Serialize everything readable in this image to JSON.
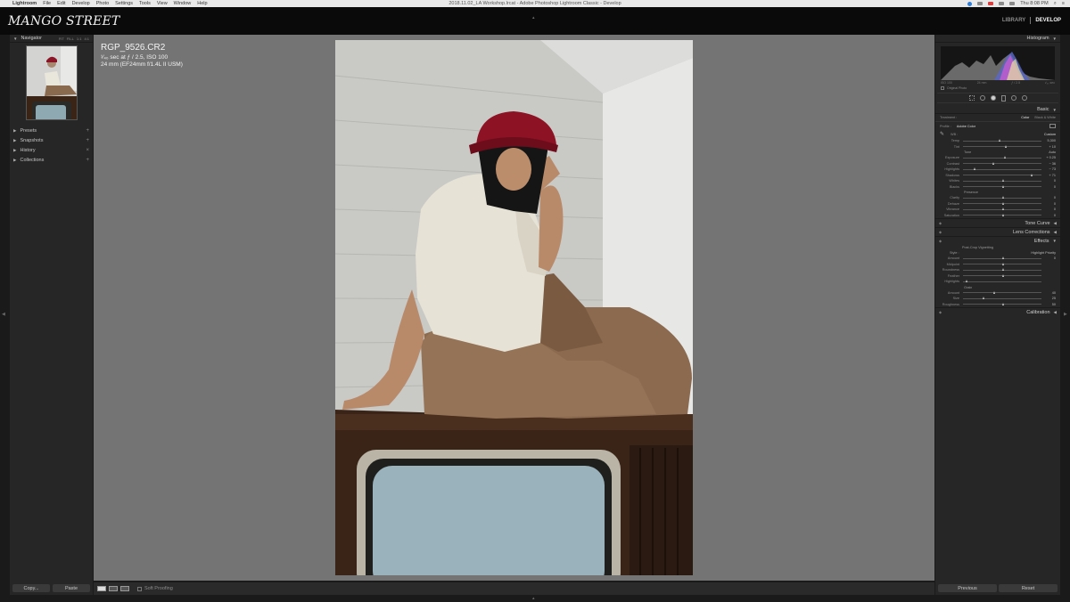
{
  "menubar": {
    "items": [
      "Lightroom",
      "File",
      "Edit",
      "Develop",
      "Photo",
      "Settings",
      "Tools",
      "View",
      "Window",
      "Help"
    ],
    "title": "2018.11.02_LA Workshop.lrcat - Adobe Photoshop Lightroom Classic - Develop",
    "clock": "Thu 8:08 PM"
  },
  "identity": {
    "logo": "MANGO STREET",
    "modules": [
      "LIBRARY",
      "DEVELOP"
    ]
  },
  "left_panel": {
    "navigator": {
      "title": "Navigator",
      "options": [
        "FIT",
        "FILL",
        "1:1",
        "4:1"
      ]
    },
    "sections": [
      {
        "label": "Presets"
      },
      {
        "label": "Snapshots"
      },
      {
        "label": "History"
      },
      {
        "label": "Collections"
      }
    ]
  },
  "image_info": {
    "filename": "RGP_9526.CR2",
    "exposure": "¹⁄₄₀ sec at ƒ / 2.5, ISO 100",
    "lens": "24 mm (EF24mm f/1.4L II USM)"
  },
  "right_panel": {
    "histogram": {
      "title": "Histogram",
      "meta": [
        "ISO 100",
        "24 mm",
        "ƒ / 2.5",
        "¹⁄₄₀ sec"
      ],
      "original_photo": "Original Photo"
    },
    "basic": {
      "title": "Basic",
      "treatment_label": "Treatment :",
      "treatment_options": [
        "Color",
        "Black & White"
      ],
      "profile_label": "Profile :",
      "profile_value": "Adobe Color",
      "wb_label": "WB :",
      "wb_value": "Custom",
      "wb_sliders": [
        {
          "label": "Temp",
          "value": "5,300",
          "pos": 0.45
        },
        {
          "label": "Tint",
          "value": "+ 10",
          "pos": 0.53
        }
      ],
      "tone_label": "Tone",
      "tone_auto": "Auto",
      "tone_sliders": [
        {
          "label": "Exposure",
          "value": "+ 0.25",
          "pos": 0.52
        },
        {
          "label": "Contrast",
          "value": "− 36",
          "pos": 0.38
        },
        {
          "label": "Highlights",
          "value": "− 73",
          "pos": 0.14
        },
        {
          "label": "Shadows",
          "value": "+ 71",
          "pos": 0.86
        },
        {
          "label": "Whites",
          "value": "0",
          "pos": 0.5
        },
        {
          "label": "Blacks",
          "value": "0",
          "pos": 0.5
        }
      ],
      "presence_label": "Presence",
      "presence_sliders": [
        {
          "label": "Clarity",
          "value": "0",
          "pos": 0.5
        },
        {
          "label": "Dehaze",
          "value": "0",
          "pos": 0.5
        },
        {
          "label": "Vibrance",
          "value": "0",
          "pos": 0.5
        },
        {
          "label": "Saturation",
          "value": "0",
          "pos": 0.5
        }
      ]
    },
    "collapsed_panels": [
      "Tone Curve",
      "Lens Corrections"
    ],
    "effects": {
      "title": "Effects",
      "vignette_label": "Post-Crop Vignetting",
      "style_label": "Style :",
      "style_value": "Highlight Priority",
      "vignette_sliders": [
        {
          "label": "Amount",
          "value": "0",
          "pos": 0.5
        },
        {
          "label": "Midpoint",
          "value": "",
          "pos": 0.5
        },
        {
          "label": "Roundness",
          "value": "",
          "pos": 0.5
        },
        {
          "label": "Feather",
          "value": "",
          "pos": 0.5
        },
        {
          "label": "Highlights",
          "value": "",
          "pos": 0.03
        }
      ],
      "grain_label": "Grain",
      "grain_sliders": [
        {
          "label": "Amount",
          "value": "40",
          "pos": 0.39
        },
        {
          "label": "Size",
          "value": "25",
          "pos": 0.25
        },
        {
          "label": "Roughness",
          "value": "50",
          "pos": 0.5
        }
      ]
    },
    "calibration": "Calibration"
  },
  "bottom": {
    "copy": "Copy...",
    "paste": "Paste",
    "soft_proofing": "Soft Proofing",
    "previous": "Previous",
    "reset": "Reset"
  }
}
